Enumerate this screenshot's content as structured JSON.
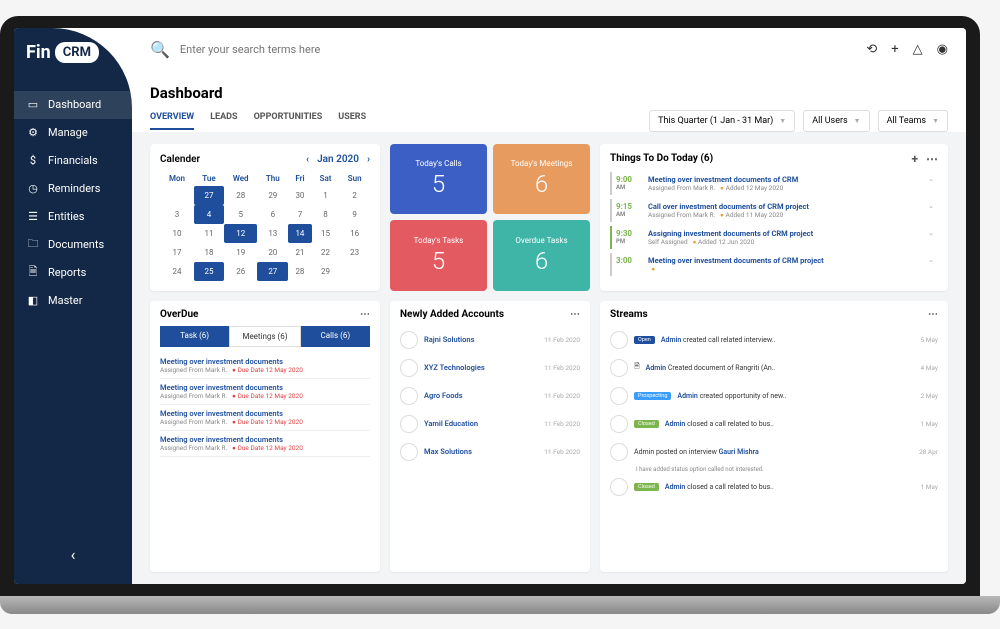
{
  "brand": {
    "fin": "Fin",
    "crm": "CRM"
  },
  "search": {
    "placeholder": "Enter your search terms here"
  },
  "sidebar": {
    "items": [
      {
        "icon": "▭",
        "label": "Dashboard",
        "active": true
      },
      {
        "icon": "⚙",
        "label": "Manage"
      },
      {
        "icon": "$",
        "label": "Financials"
      },
      {
        "icon": "◷",
        "label": "Reminders"
      },
      {
        "icon": "☰",
        "label": "Entities"
      },
      {
        "icon": "🗀",
        "label": "Documents"
      },
      {
        "icon": "🗎",
        "label": "Reports"
      },
      {
        "icon": "◧",
        "label": "Master"
      }
    ]
  },
  "header": {
    "title": "Dashboard",
    "tabs": [
      "OVERVIEW",
      "LEADS",
      "OPPORTUNITIES",
      "USERS"
    ],
    "activeTab": 0,
    "filters": {
      "period": "This Quarter (1 Jan - 31 Mar)",
      "users": "All Users",
      "teams": "All Teams"
    }
  },
  "calendar": {
    "title": "Calender",
    "month": "Jan 2020",
    "days": [
      "Mon",
      "Tue",
      "Wed",
      "Thu",
      "Fri",
      "Sat",
      "Sun"
    ],
    "weeks": [
      [
        " ",
        "27",
        "28",
        "29",
        "30",
        "1",
        "2"
      ],
      [
        "3",
        "4",
        "5",
        "6",
        "7",
        "8",
        "9"
      ],
      [
        "10",
        "11",
        "12",
        "13",
        "14",
        "15",
        "16"
      ],
      [
        "17",
        "18",
        "19",
        "20",
        "21",
        "22",
        "23"
      ],
      [
        "24",
        "25",
        "26",
        "27",
        "28",
        "29",
        " "
      ]
    ],
    "selected": [
      "4",
      "12",
      "14",
      "25",
      "27"
    ]
  },
  "stats": {
    "calls": {
      "label": "Today's Calls",
      "value": "5"
    },
    "meetings": {
      "label": "Today's Meetings",
      "value": "6"
    },
    "tasks": {
      "label": "Today's Tasks",
      "value": "5"
    },
    "overdue": {
      "label": "Overdue Tasks",
      "value": "6"
    }
  },
  "todo": {
    "title": "Things To Do Today (6)",
    "items": [
      {
        "time": "9:00",
        "ampm": "AM",
        "title": "Meeting over investment documents of CRM",
        "meta": "Assigned From Mark R.",
        "added": "Added 12 May 2020"
      },
      {
        "time": "9:15",
        "ampm": "AM",
        "title": "Call over investment documents of CRM project",
        "meta": "Assigned From Mark R.",
        "added": "Added 11 May 2020"
      },
      {
        "time": "9:30",
        "ampm": "PM",
        "title": "Assigning investment documents of CRM project",
        "meta": "Self Assigned",
        "added": "Added 12 Jun 2020",
        "g": true
      },
      {
        "time": "3:00",
        "ampm": "",
        "title": "Meeting over investment documents of CRM project",
        "meta": "",
        "added": ""
      }
    ]
  },
  "overdue": {
    "title": "OverDue",
    "tabs": [
      "Task (6)",
      "Meetings (6)",
      "Calls (6)"
    ],
    "activeTab": 1,
    "items": [
      {
        "title": "Meeting over investment documents",
        "from": "Assigned From Mark R.",
        "due": "Due Date 12 May 2020"
      },
      {
        "title": "Meeting over investment documents",
        "from": "Assigned From Mark R.",
        "due": "Due Date 12 May 2020"
      },
      {
        "title": "Meeting over investment documents",
        "from": "Assigned From Mark R.",
        "due": "Due Date 12 May 2020"
      },
      {
        "title": "Meeting over investment documents",
        "from": "Assigned From Mark R.",
        "due": "Due Date 12 May 2020"
      }
    ]
  },
  "accounts": {
    "title": "Newly Added Accounts",
    "items": [
      {
        "name": "Rajni Solutions",
        "date": "11 Feb 2020"
      },
      {
        "name": "XYZ Technologies",
        "date": "11 Feb 2020"
      },
      {
        "name": "Agro Foods",
        "date": "11 Feb 2020"
      },
      {
        "name": "Yamil Education",
        "date": "11 Feb 2020"
      },
      {
        "name": "Max Solutions",
        "date": "11 Feb 2020"
      }
    ]
  },
  "streams": {
    "title": "Streams",
    "items": [
      {
        "badge": "Open",
        "badgeCls": "open",
        "txt": "Admin created call related interview..",
        "date": "5 May"
      },
      {
        "icon": "🗎",
        "txt": "Admin Created document of Rangriti (An..",
        "date": "4 May"
      },
      {
        "badge": "Prospecting",
        "badgeCls": "pros",
        "txt": "Admin created opportunity of new..",
        "date": "2 May"
      },
      {
        "badge": "Closed",
        "badgeCls": "closed",
        "txt": "Admin closed a call related to bus..",
        "date": "1 May"
      },
      {
        "plain": "Admin posted on interview",
        "link": "Gauri Mishra",
        "note": "I have added status option called not interested.",
        "date": "28 Apr"
      },
      {
        "badge": "Closed",
        "badgeCls": "closed",
        "txt": "Admin closed a call related to bus..",
        "date": "1 May"
      }
    ]
  }
}
